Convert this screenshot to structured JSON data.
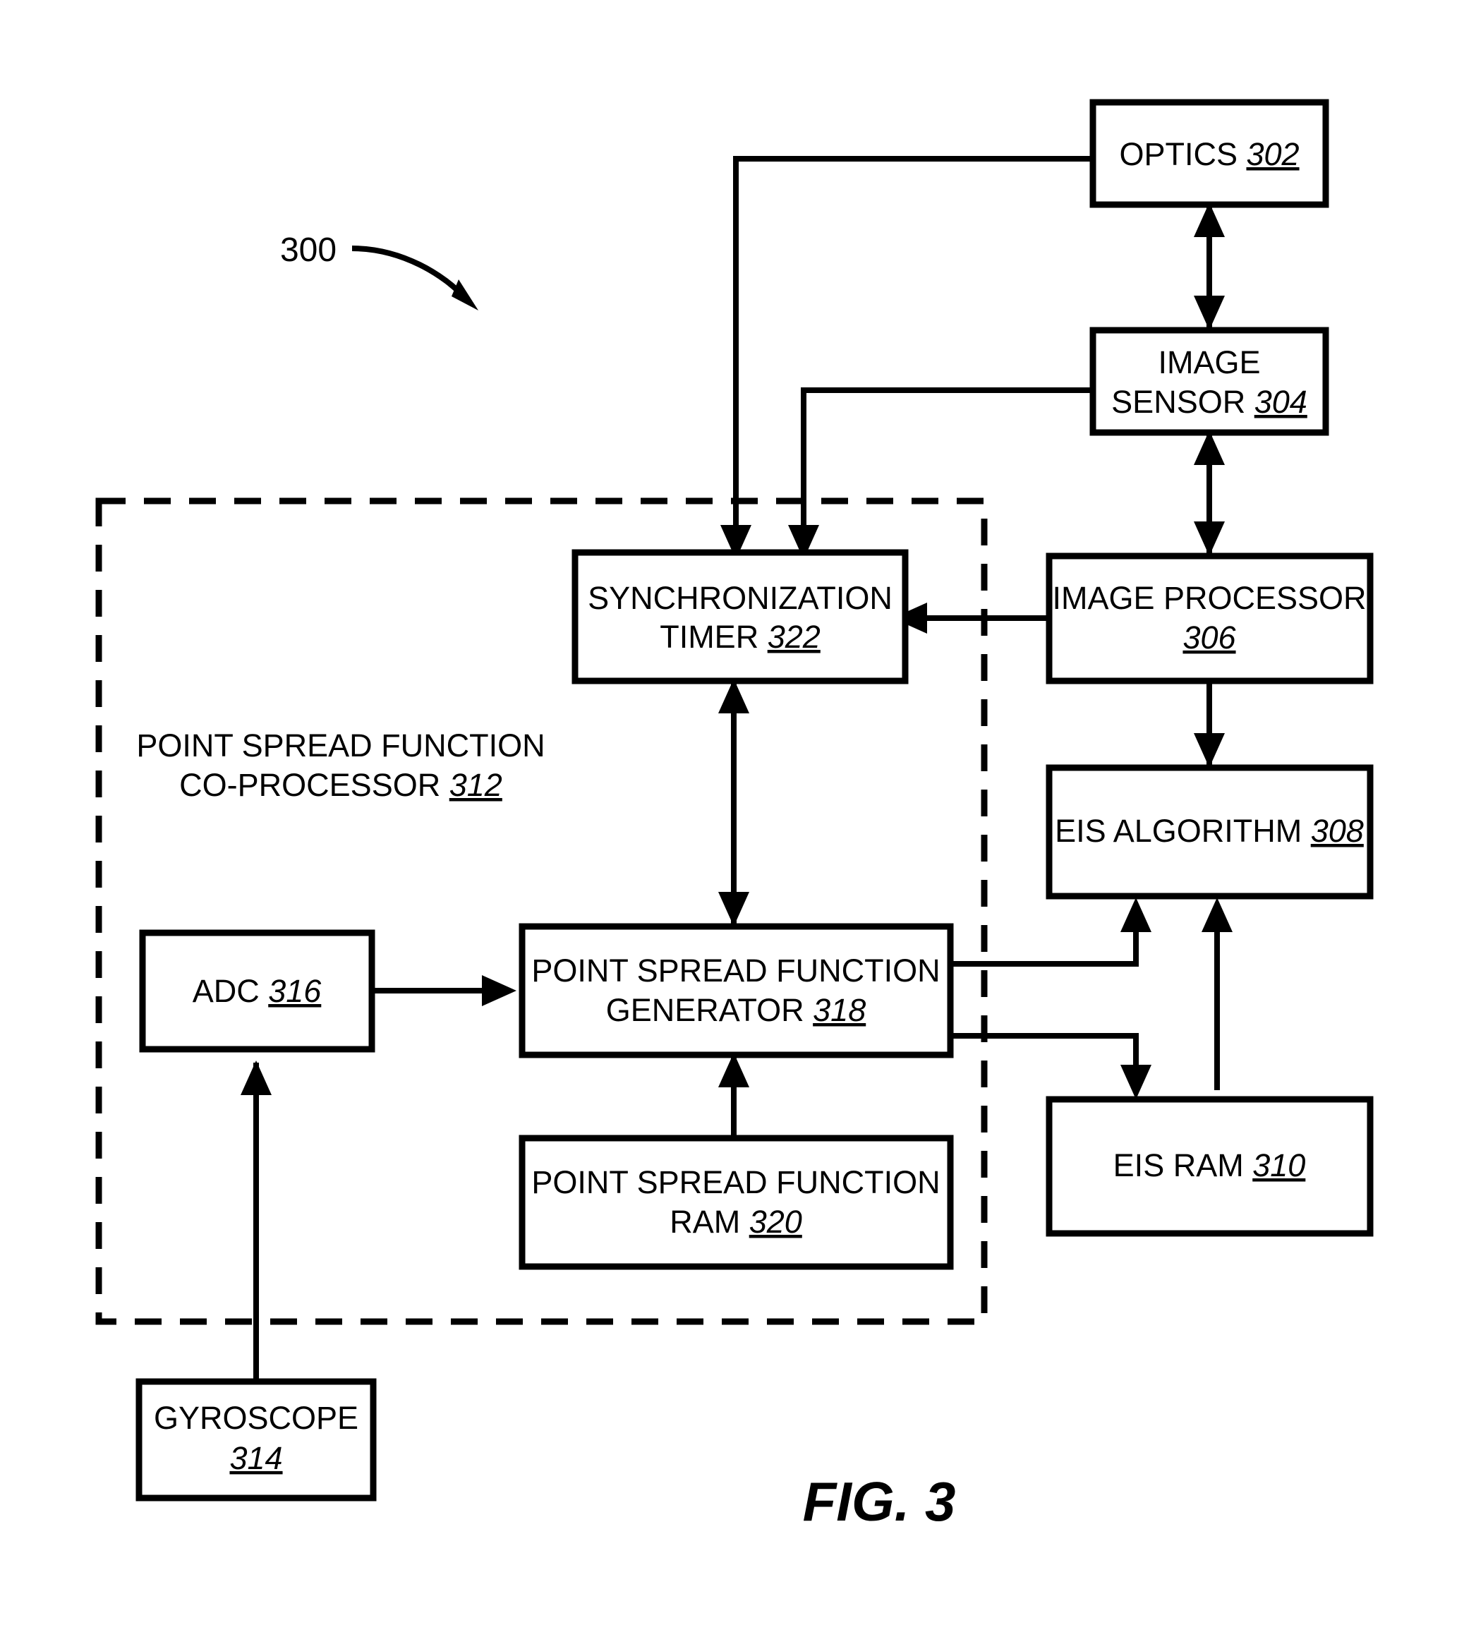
{
  "figure": {
    "caption": "FIG. 3",
    "system_ref": "300"
  },
  "region": {
    "name": "point-spread-function-co-processor",
    "line1": "POINT SPREAD FUNCTION",
    "line2": "CO-PROCESSOR ",
    "ref": "312"
  },
  "blocks": [
    {
      "id": "optics",
      "line1": "OPTICS ",
      "line2": "",
      "ref": "302"
    },
    {
      "id": "image-sensor",
      "line1": "IMAGE",
      "line2": "SENSOR ",
      "ref": "304"
    },
    {
      "id": "image-processor",
      "line1": "IMAGE PROCESSOR",
      "line2": "",
      "ref": "306"
    },
    {
      "id": "eis-algorithm",
      "line1": "EIS ALGORITHM ",
      "line2": "",
      "ref": "308"
    },
    {
      "id": "eis-ram",
      "line1": "EIS RAM ",
      "line2": "",
      "ref": "310"
    },
    {
      "id": "gyroscope",
      "line1": "GYROSCOPE",
      "line2": "",
      "ref": "314"
    },
    {
      "id": "adc",
      "line1": "ADC ",
      "line2": "",
      "ref": "316"
    },
    {
      "id": "psf-generator",
      "line1": "POINT SPREAD FUNCTION",
      "line2": "GENERATOR ",
      "ref": "318"
    },
    {
      "id": "psf-ram",
      "line1": "POINT SPREAD FUNCTION",
      "line2": "RAM ",
      "ref": "320"
    },
    {
      "id": "sync-timer",
      "line1": "SYNCHRONIZATION",
      "line2": "TIMER ",
      "ref": "322"
    }
  ],
  "colors": {
    "stroke": "#000000",
    "fill": "#ffffff",
    "background": "#ffffff"
  }
}
